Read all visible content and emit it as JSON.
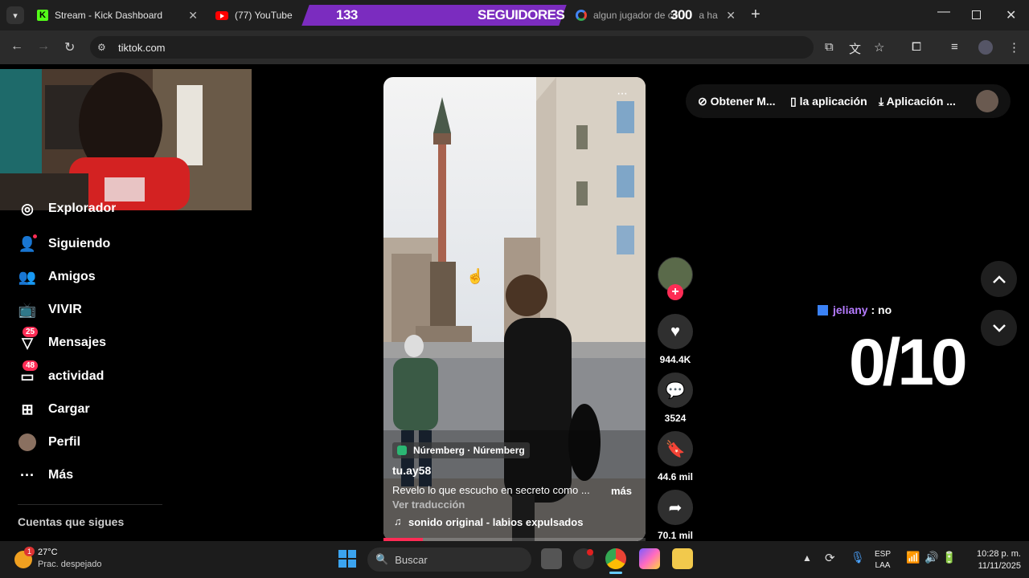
{
  "browser": {
    "tabs": [
      {
        "label": "Stream - Kick Dashboard"
      },
      {
        "label": "(77) YouTube"
      },
      {
        "label": "algun jugador de co"
      },
      {
        "label": "a ha"
      }
    ],
    "address": "tiktok.com",
    "new_tab": "+"
  },
  "overlay": {
    "followers_count": "133",
    "followers_label": "SEGUIDORES",
    "followers_goal": "300",
    "chat_user": "jeliany",
    "chat_sep": " : ",
    "chat_message": "no",
    "rating": "0/10"
  },
  "sidebar": {
    "items": [
      {
        "label": "Explorador",
        "icon": "compass-icon"
      },
      {
        "label": "Siguiendo",
        "icon": "following-icon"
      },
      {
        "label": "Amigos",
        "icon": "friends-icon"
      },
      {
        "label": "VIVIR",
        "icon": "live-icon"
      },
      {
        "label": "Mensajes",
        "icon": "messages-icon",
        "badge": "25"
      },
      {
        "label": "actividad",
        "icon": "activity-icon",
        "badge": "48"
      },
      {
        "label": "Cargar",
        "icon": "upload-icon"
      },
      {
        "label": "Perfil",
        "icon": "avatar"
      },
      {
        "label": "Más",
        "icon": "more-icon"
      }
    ],
    "following_header": "Cuentas que sigues"
  },
  "header": {
    "get_coins": "Obtener M...",
    "app": "la aplicación",
    "download_app": "Aplicación ..."
  },
  "video": {
    "location": "Núremberg · Núremberg",
    "author": "tu.ay58",
    "caption": "Revelo lo que escucho en secreto como ...",
    "more": "más",
    "translate": "Ver traducción",
    "sound": "sonido original - labios expulsados",
    "progress": 0.15
  },
  "actions": {
    "likes": "944.4K",
    "comments": "3524",
    "saves": "44.6 mil",
    "shares": "70.1 mil"
  },
  "taskbar": {
    "temperature": "27°C",
    "weather": "Prac. despejado",
    "weather_badge": "1",
    "search": "Buscar",
    "lang": "ESP",
    "lang_sub": "LAA",
    "time": "10:28 p. m.",
    "date": "11/11/2025"
  },
  "colors": {
    "accent_pink": "#fe2c55",
    "banner_purple": "#7b2cbf",
    "chat_user": "#b57bff"
  }
}
